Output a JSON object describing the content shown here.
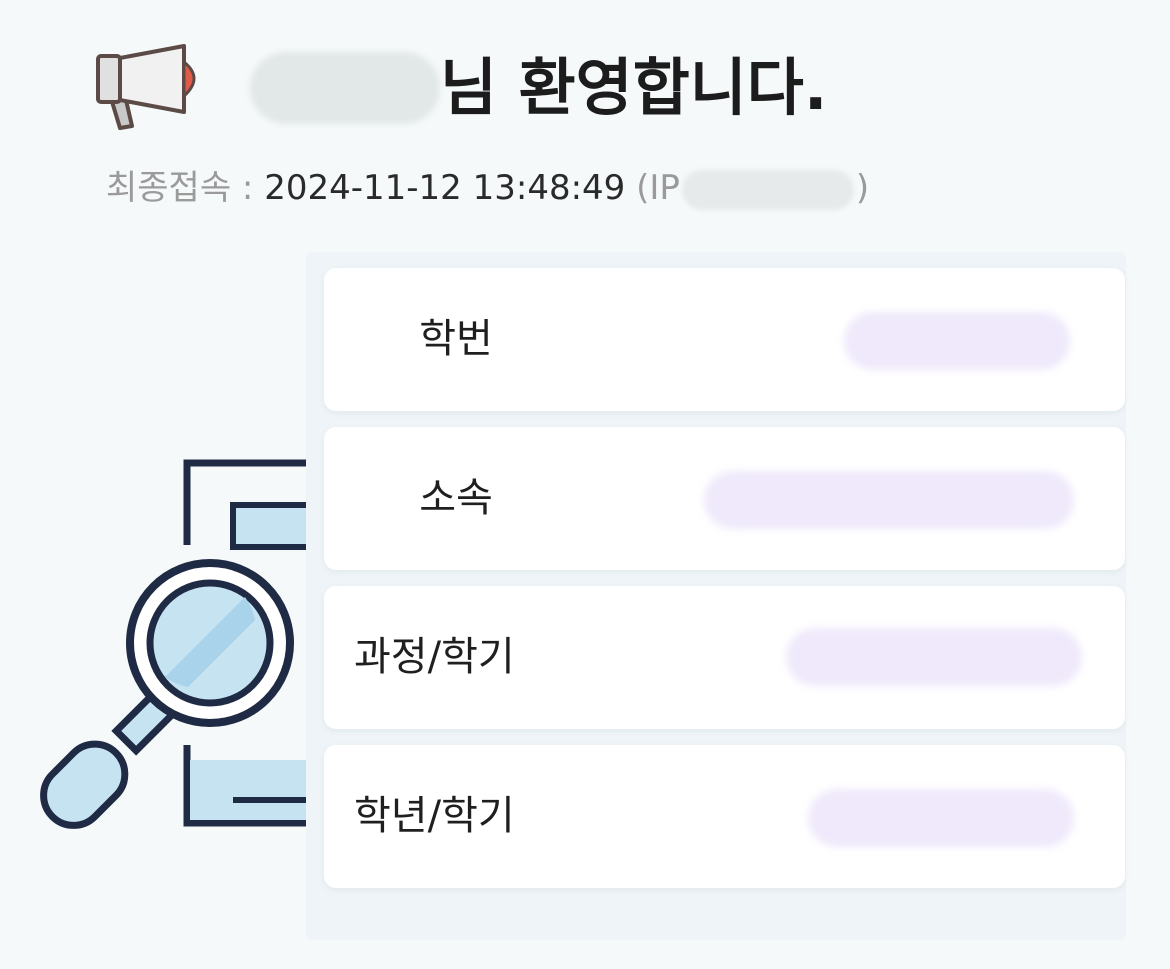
{
  "welcome": {
    "user_name": "",
    "suffix": "님 환영합니다."
  },
  "last_login": {
    "label": "최종접속 : ",
    "datetime": "2024-11-12 13:48:49",
    "ip_open": "(IP",
    "ip_value": "",
    "ip_close": ")"
  },
  "icons": {
    "megaphone": "megaphone-icon",
    "search_document": "search-document-icon"
  },
  "info_cards": [
    {
      "label": "학번",
      "value": ""
    },
    {
      "label": "소속",
      "value": ""
    },
    {
      "label": "과정/학기",
      "value": ""
    },
    {
      "label": "학년/학기",
      "value": ""
    }
  ],
  "colors": {
    "background": "#f5f9fa",
    "card": "#ffffff",
    "redacted": "#efe9fb",
    "megaphone_accent": "#e05a4a",
    "illustration_blue": "#c6e3f2",
    "illustration_outline": "#1f2a44"
  }
}
